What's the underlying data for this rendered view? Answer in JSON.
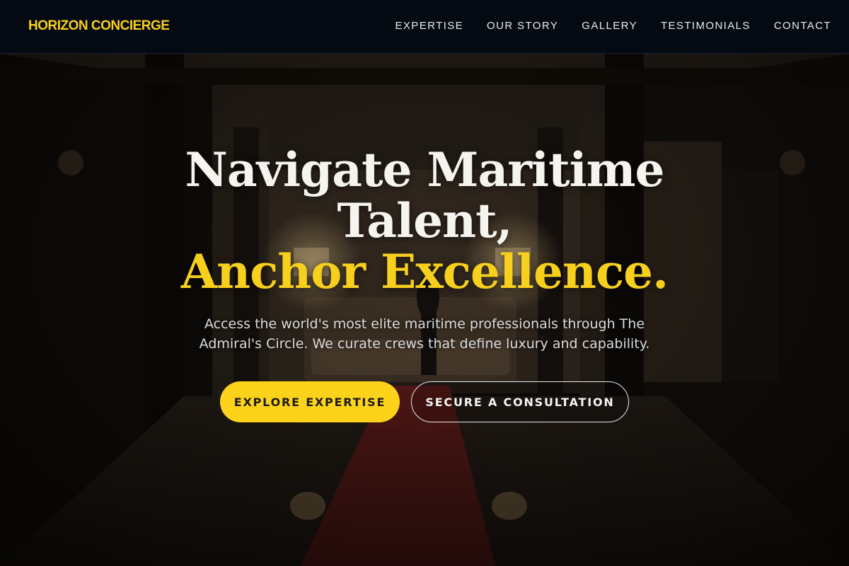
{
  "header": {
    "brand": "HORIZON CONCIERGE",
    "nav": [
      {
        "label": "EXPERTISE"
      },
      {
        "label": "OUR STORY"
      },
      {
        "label": "GALLERY"
      },
      {
        "label": "TESTIMONIALS"
      },
      {
        "label": "CONTACT"
      }
    ]
  },
  "hero": {
    "headline_line1": "Navigate Maritime",
    "headline_line2": "Talent,",
    "headline_accent": "Anchor Excellence.",
    "subtext": "Access the world's most elite maritime professionals through The Admiral's Circle. We curate crews that define luxury and capability.",
    "primary_cta": "EXPLORE EXPERTISE",
    "secondary_cta": "SECURE A CONSULTATION"
  },
  "colors": {
    "accent": "#f7cf1d",
    "header_bg": "#050a12",
    "text_light": "#f6f4ef"
  }
}
